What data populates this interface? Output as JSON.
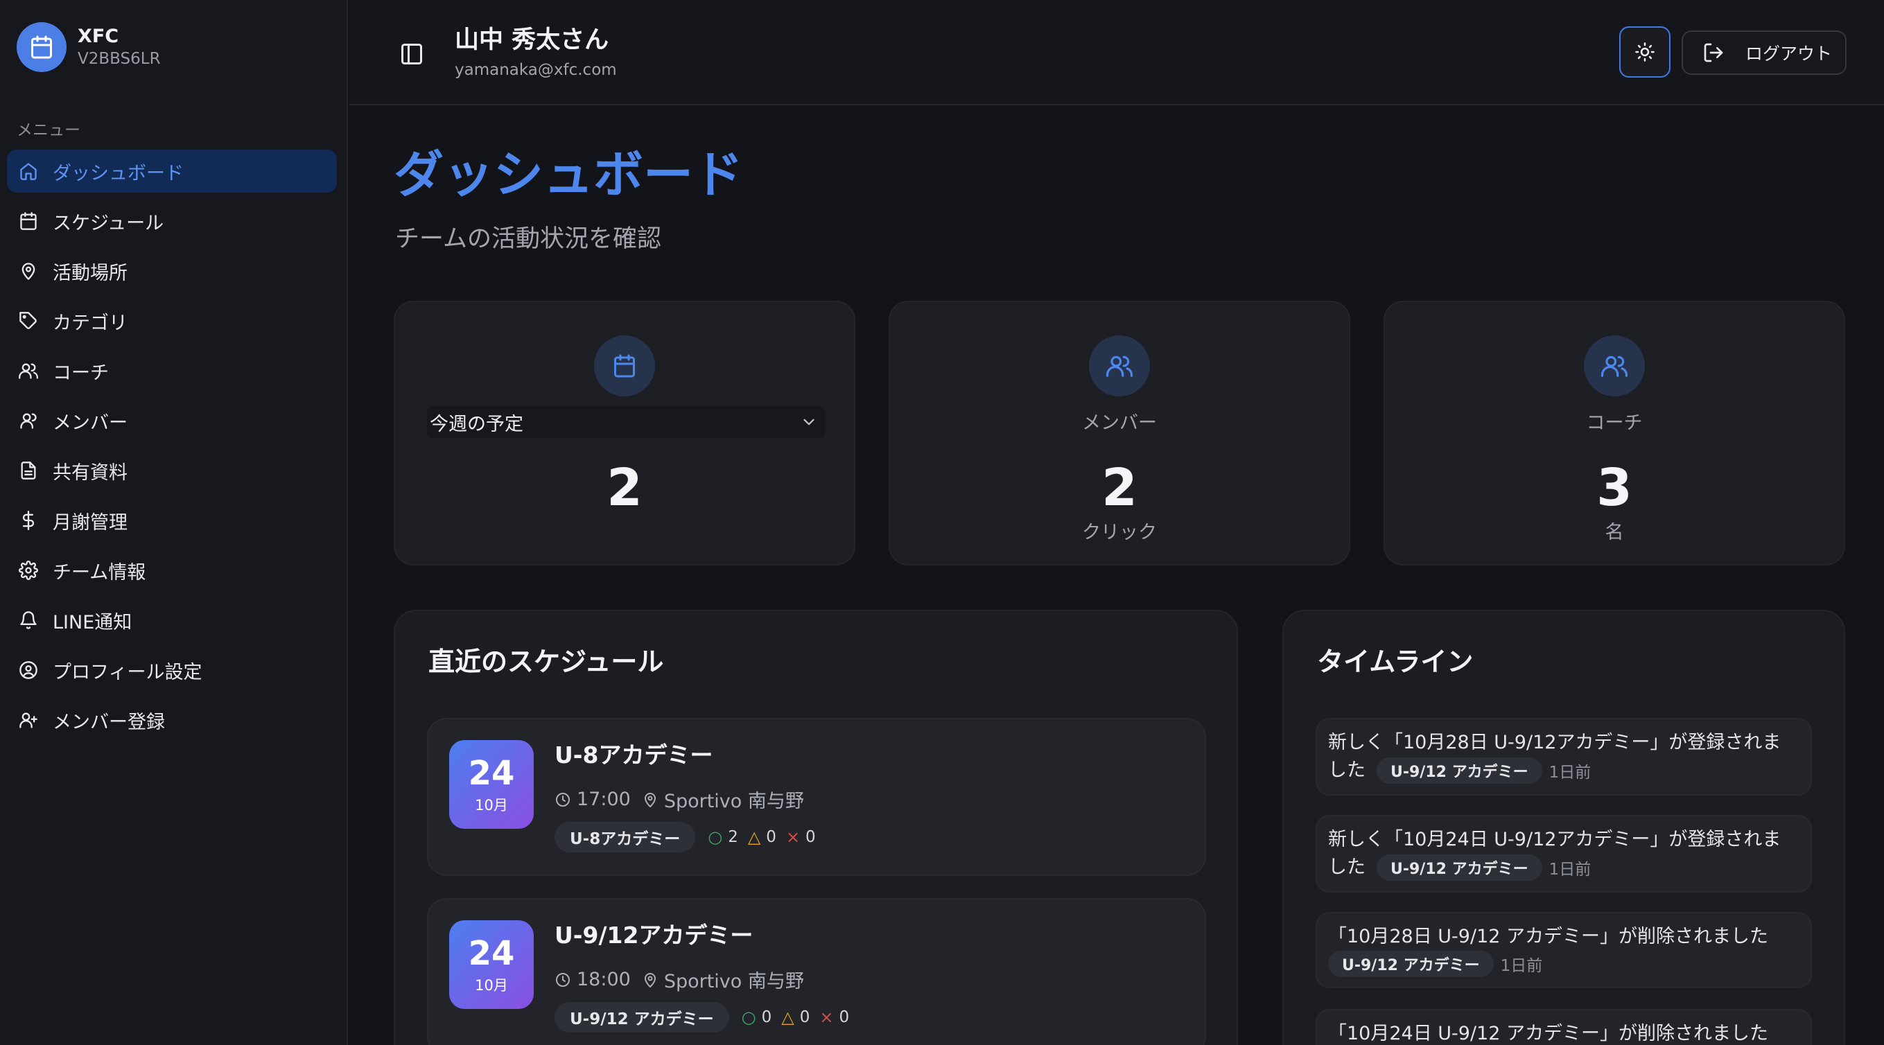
{
  "brand": {
    "name": "XFC",
    "code": "V2BBS6LR"
  },
  "sidebar": {
    "heading": "メニュー",
    "items": [
      {
        "label": "ダッシュボード",
        "icon": "home-icon",
        "active": true
      },
      {
        "label": "スケジュール",
        "icon": "calendar-icon"
      },
      {
        "label": "活動場所",
        "icon": "map-pin-icon"
      },
      {
        "label": "カテゴリ",
        "icon": "tag-icon"
      },
      {
        "label": "コーチ",
        "icon": "users-icon"
      },
      {
        "label": "メンバー",
        "icon": "user-icon"
      },
      {
        "label": "共有資料",
        "icon": "file-icon"
      },
      {
        "label": "月謝管理",
        "icon": "dollar-icon"
      },
      {
        "label": "チーム情報",
        "icon": "gear-icon"
      },
      {
        "label": "LINE通知",
        "icon": "bell-icon"
      },
      {
        "label": "プロフィール設定",
        "icon": "user-circle-icon"
      },
      {
        "label": "メンバー登録",
        "icon": "user-plus-icon"
      }
    ]
  },
  "header": {
    "user_name": "山中 秀太さん",
    "user_email": "yamanaka@xfc.com",
    "logout_label": "ログアウト"
  },
  "page": {
    "title": "ダッシュボード",
    "subtitle": "チームの活動状況を確認"
  },
  "stats": {
    "schedule": {
      "select_value": "今週の予定",
      "value": "2"
    },
    "members": {
      "label": "メンバー",
      "value": "2",
      "sub": "クリック"
    },
    "coaches": {
      "label": "コーチ",
      "value": "3",
      "sub": "名"
    }
  },
  "schedule": {
    "title": "直近のスケジュール",
    "items": [
      {
        "day": "24",
        "month": "10月",
        "title": "U-8アカデミー",
        "time": "17:00",
        "place": "Sportivo 南与野",
        "tag": "U-8アカデミー",
        "ok": "2",
        "maybe": "0",
        "ng": "0"
      },
      {
        "day": "24",
        "month": "10月",
        "title": "U-9/12アカデミー",
        "time": "18:00",
        "place": "Sportivo 南与野",
        "tag": "U-9/12 アカデミー",
        "ok": "0",
        "maybe": "0",
        "ng": "0"
      }
    ]
  },
  "timeline": {
    "title": "タイムライン",
    "items": [
      {
        "text": "新しく「10月28日 U-9/12アカデミー」が登録されま",
        "cont": "した",
        "tag": "U-9/12 アカデミー",
        "time": "1日前"
      },
      {
        "text": "新しく「10月24日 U-9/12アカデミー」が登録されま",
        "cont": "した",
        "tag": "U-9/12 アカデミー",
        "time": "1日前"
      },
      {
        "text": "「10月28日 U-9/12 アカデミー」が削除されました",
        "cont": "",
        "tag": "U-9/12 アカデミー",
        "time": "1日前"
      },
      {
        "text": "「10月24日 U-9/12 アカデミー」が削除されました",
        "cont": "",
        "tag": "",
        "time": ""
      }
    ]
  },
  "colors": {
    "accent": "#4d87ee",
    "active_bg": "#112a56",
    "ok": "#3fa66a",
    "maybe": "#e0a21a",
    "ng": "#e0493f"
  }
}
